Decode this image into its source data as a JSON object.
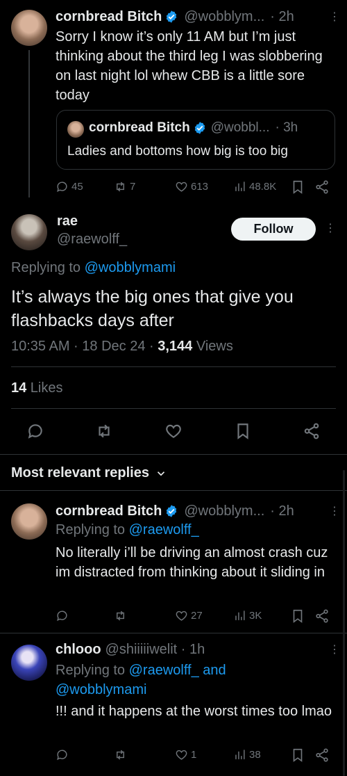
{
  "quoted_tweet": {
    "author_name": "cornbread Bitch",
    "handle": "@wobblym...",
    "time": "· 2h",
    "text": "Sorry I know it’s only 11 AM but I’m just thinking about the third leg I was slobbering on last night lol whew CBB is a little sore today",
    "embedded": {
      "author_name": "cornbread Bitch",
      "handle": "@wobbl...",
      "time": "· 3h",
      "text": "Ladies and bottoms how big is too big"
    },
    "stats": {
      "replies": "45",
      "reposts": "7",
      "likes": "613",
      "views": "48.8K"
    }
  },
  "main_tweet": {
    "author_name": "rae",
    "handle": "@raewolff_",
    "follow_label": "Follow",
    "replying_prefix": "Replying to ",
    "replying_to": "@wobblymami",
    "text": "It’s always the big ones that give you flashbacks days after",
    "time": "10:35 AM · 18 Dec 24 · ",
    "views_count": "3,144",
    "views_label": " Views",
    "likes_count": "14",
    "likes_label": " Likes"
  },
  "replies_header": {
    "label": "Most relevant replies"
  },
  "replies": [
    {
      "author_name": "cornbread Bitch",
      "handle": "@wobblym...",
      "time": "· 2h",
      "replying_prefix": "Replying to ",
      "replying_to": "@raewolff_",
      "text": "No literally i’ll be driving an almost crash cuz im distracted from thinking about it sliding in",
      "stats": {
        "likes": "27",
        "views": "3K"
      }
    },
    {
      "author_name": "chlooo",
      "handle": "@shiiiiiwelit · 1h",
      "replying_prefix": "Replying to ",
      "replying_to": "@raewolff_ and",
      "replying_to_2": "@wobblymami",
      "text": "!!! and it happens at the worst times too lmao",
      "stats": {
        "likes": "1",
        "views": "38"
      }
    }
  ],
  "colors": {
    "background": "#000000",
    "accent": "#1d9bf0",
    "muted": "#71767b",
    "divider": "#2f3336"
  }
}
